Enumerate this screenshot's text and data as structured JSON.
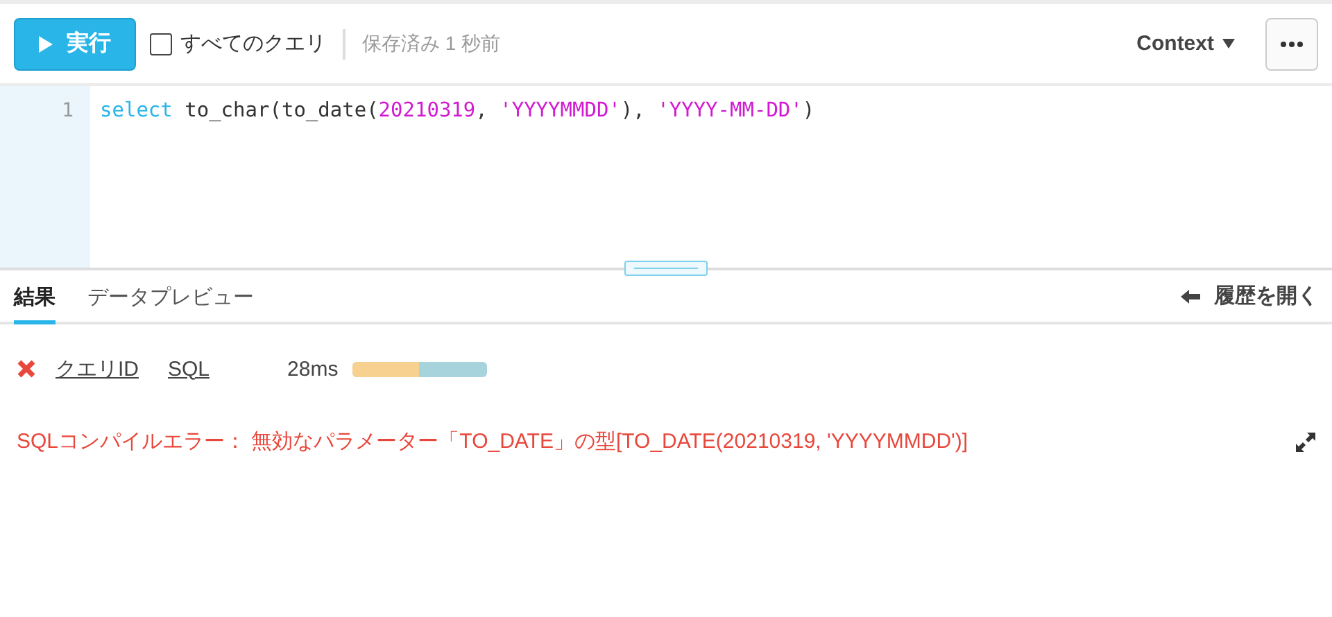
{
  "toolbar": {
    "run_button": "実行",
    "all_queries": {
      "label": "すべてのクエリ",
      "checked": false
    },
    "saved_status": "保存済み 1 秒前",
    "context_menu": "Context"
  },
  "editor": {
    "lines": [
      {
        "number": "1",
        "tokens": [
          {
            "kind": "keyword",
            "text": "select"
          },
          {
            "kind": "plain",
            "text": " to_char(to_date("
          },
          {
            "kind": "number",
            "text": "20210319"
          },
          {
            "kind": "plain",
            "text": ", "
          },
          {
            "kind": "string",
            "text": "'YYYYMMDD'"
          },
          {
            "kind": "plain",
            "text": "), "
          },
          {
            "kind": "string",
            "text": "'YYYY-MM-DD'"
          },
          {
            "kind": "plain",
            "text": ")"
          }
        ]
      }
    ]
  },
  "result_tabs": [
    {
      "label": "結果",
      "selected": true
    },
    {
      "label": "データプレビュー",
      "selected": false
    }
  ],
  "history_link": "履歴を開く",
  "result": {
    "failed": true,
    "query_id_link": "クエリID",
    "sql_link": "SQL",
    "duration": "28ms",
    "error_message": "SQLコンパイルエラー： 無効なパラメーター「TO_DATE」の型[TO_DATE(20210319, 'YYYYMMDD')]"
  }
}
